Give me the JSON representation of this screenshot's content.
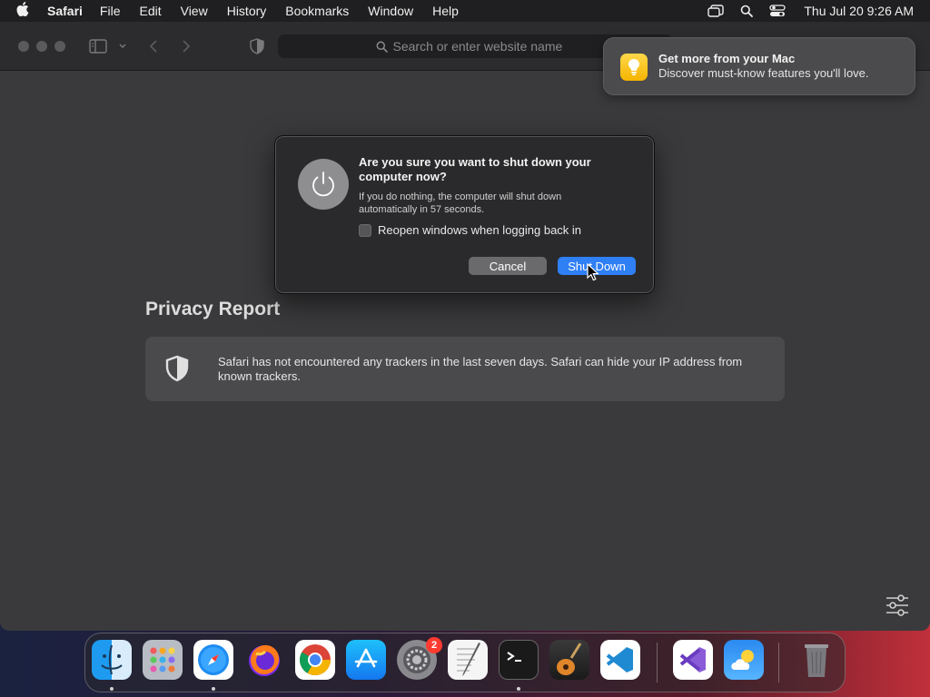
{
  "menubar": {
    "app_name": "Safari",
    "items": [
      "File",
      "Edit",
      "View",
      "History",
      "Bookmarks",
      "Window",
      "Help"
    ],
    "clock": "Thu Jul 20  9:26 AM"
  },
  "toolbar": {
    "search_placeholder": "Search or enter website name"
  },
  "privacy": {
    "title": "Privacy Report",
    "message": "Safari has not encountered any trackers in the last seven days. Safari can hide your IP address from known trackers."
  },
  "notification": {
    "title": "Get more from your Mac",
    "body": "Discover must-know features you'll love."
  },
  "dialog": {
    "title": "Are you sure you want to shut down your computer now?",
    "body": "If you do nothing, the computer will shut down automatically in 57 seconds.",
    "checkbox_label": "Reopen windows when logging back in",
    "checkbox_checked": false,
    "cancel_label": "Cancel",
    "confirm_label": "Shut Down"
  },
  "dock": {
    "apps": [
      "Finder",
      "Launchpad",
      "Safari",
      "Firefox",
      "Chrome",
      "App Store",
      "System Settings",
      "TextEdit",
      "Terminal",
      "GarageBand",
      "Visual Studio Code",
      "Visual Studio",
      "Weather",
      "Trash"
    ],
    "settings_badge": "2"
  },
  "colors": {
    "accent": "#2f7ff5",
    "window_bg": "#3a3a3c",
    "dialog_bg": "#2a2a2c"
  }
}
